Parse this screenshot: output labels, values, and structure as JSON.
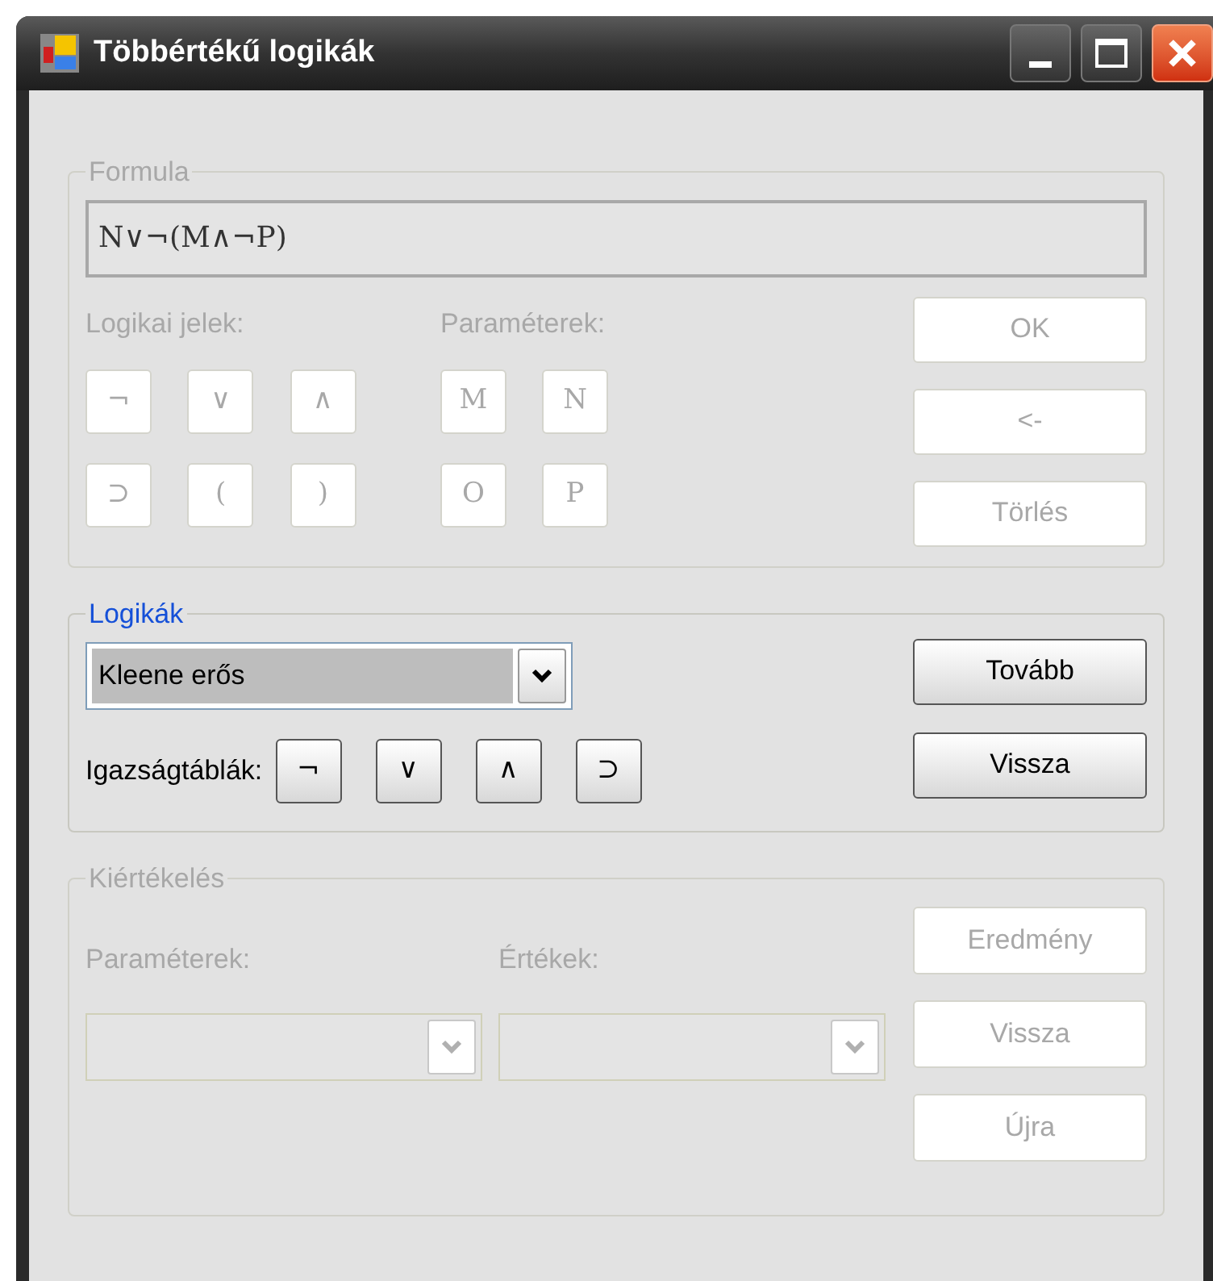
{
  "window": {
    "title": "Többértékű logikák"
  },
  "formula": {
    "title": "Formula",
    "disabled": true,
    "value": "N∨¬(M∧¬P)",
    "symbols_label": "Logikai jelek:",
    "parameters_label": "Paraméterek:",
    "symbols": [
      {
        "label": "¬",
        "disabled": true
      },
      {
        "label": "∨",
        "disabled": true
      },
      {
        "label": "∧",
        "disabled": true
      },
      {
        "label": "⊃",
        "disabled": true
      },
      {
        "label": "(",
        "disabled": true
      },
      {
        "label": ")",
        "disabled": true
      }
    ],
    "parameters": [
      {
        "label": "M",
        "disabled": true
      },
      {
        "label": "N",
        "disabled": true
      },
      {
        "label": "O",
        "disabled": true
      },
      {
        "label": "P",
        "disabled": true
      }
    ],
    "buttons": [
      {
        "label": "OK",
        "disabled": true
      },
      {
        "label": "<-",
        "disabled": true
      },
      {
        "label": "Törlés",
        "disabled": true
      }
    ]
  },
  "logics": {
    "title": "Logikák",
    "disabled": false,
    "selected_logic": "Kleene erős",
    "truth_tables_label": "Igazságtáblák:",
    "truth_tables": [
      {
        "label": "¬",
        "disabled": false
      },
      {
        "label": "∨",
        "disabled": false
      },
      {
        "label": "∧",
        "disabled": false
      },
      {
        "label": "⊃",
        "disabled": false
      }
    ],
    "buttons": [
      {
        "label": "Tovább",
        "disabled": false
      },
      {
        "label": "Vissza",
        "disabled": false
      }
    ]
  },
  "evaluation": {
    "title": "Kiértékelés",
    "disabled": true,
    "parameters_label": "Paraméterek:",
    "values_label": "Értékek:",
    "buttons": [
      {
        "label": "Eredmény",
        "disabled": true
      },
      {
        "label": "Vissza",
        "disabled": true
      },
      {
        "label": "Újra",
        "disabled": true
      }
    ]
  }
}
